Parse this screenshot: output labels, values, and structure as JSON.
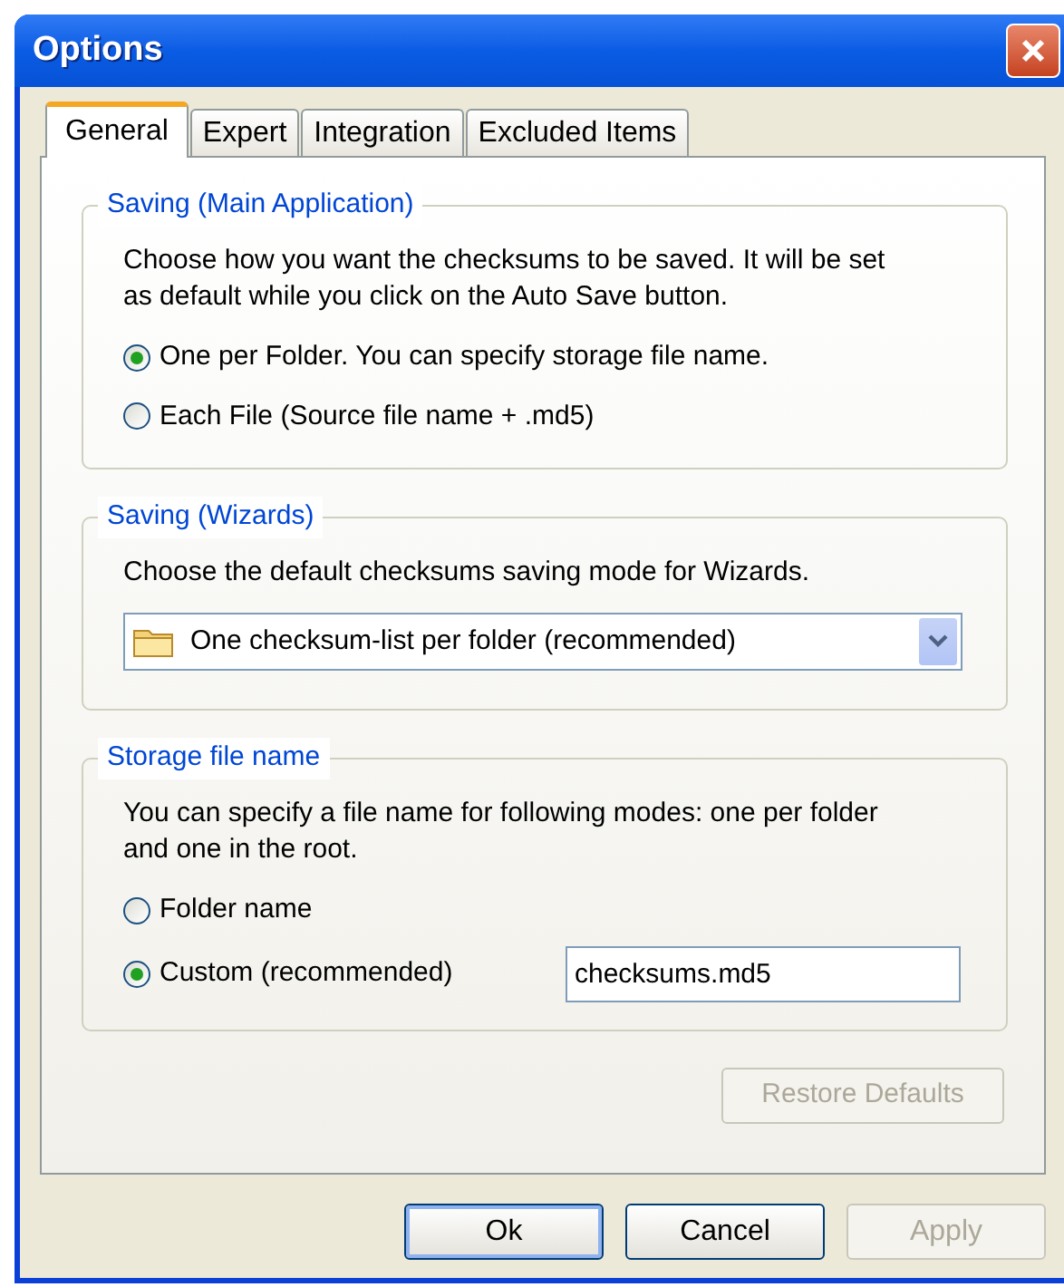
{
  "window": {
    "title": "Options"
  },
  "tabs": [
    {
      "label": "General",
      "selected": true
    },
    {
      "label": "Expert",
      "selected": false
    },
    {
      "label": "Integration",
      "selected": false
    },
    {
      "label": "Excluded Items",
      "selected": false
    }
  ],
  "saving_main": {
    "title": "Saving (Main Application)",
    "description": "Choose how you want the checksums to be saved. It will be set as default while you click on the Auto Save button.",
    "options": [
      {
        "label": "One per Folder. You can specify storage file name.",
        "selected": true
      },
      {
        "label": "Each File (Source file name + .md5)",
        "selected": false
      }
    ]
  },
  "saving_wizards": {
    "title": "Saving (Wizards)",
    "description": "Choose the default checksums saving mode for Wizards.",
    "dropdown": {
      "value": "One checksum-list per folder (recommended)"
    }
  },
  "storage": {
    "title": "Storage file name",
    "description": "You can specify a file name for following modes: one per folder and one in the root.",
    "options": [
      {
        "label": "Folder name",
        "selected": false
      },
      {
        "label": "Custom (recommended)",
        "selected": true
      }
    ],
    "file_name": {
      "value": "checksums.md5"
    }
  },
  "restore_button": {
    "label": "Restore Defaults",
    "disabled": true
  },
  "buttons": [
    {
      "label": "Ok",
      "disabled": false,
      "default": true
    },
    {
      "label": "Cancel",
      "disabled": false,
      "default": false
    },
    {
      "label": "Apply",
      "disabled": true,
      "default": false
    }
  ]
}
